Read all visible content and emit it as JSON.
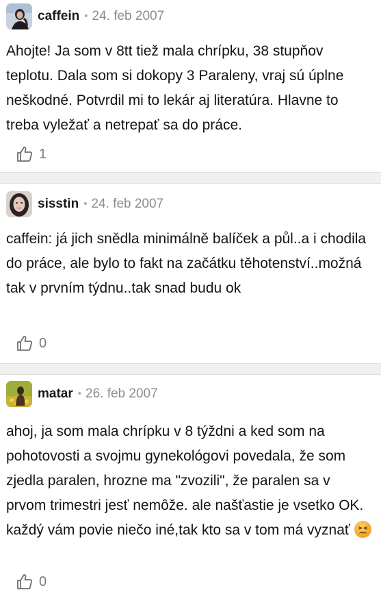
{
  "posts": [
    {
      "username": "caffein",
      "separator": "•",
      "date": "24. feb 2007",
      "text": "Ahojte! Ja som v 8tt tiež mala chrípku, 38 stupňov teplotu. Dala som si dokopy 3 Paraleny, vraj sú úplne neškodné. Potvrdil mi to lekár aj literatúra. Hlavne to treba vyležať a netrepať sa do práce.",
      "likes": "1",
      "like_icon": "thumbs-up-icon"
    },
    {
      "username": "sisstin",
      "separator": "•",
      "date": "24. feb 2007",
      "text": "caffein: já jich snědla minimálně balíček a půl..a i chodila do práce, ale bylo to fakt na začátku těhotenství..možná tak v prvním týdnu..tak snad budu ok",
      "likes": "0",
      "like_icon": "thumbs-up-icon"
    },
    {
      "username": "matar",
      "separator": "•",
      "date": "26. feb 2007",
      "text": "ahoj, ja som mala chrípku v 8 týždni a ked som na pohotovosti a svojmu gynekológovi povedala, že som zjedla paralen, hrozne ma \"zvozili\", že paralen sa v prvom trimestri jesť nemôže. ale našťastie je vsetko OK. každý vám povie niečo iné,tak kto sa v tom má vyznať",
      "emoji": "confounded-face-emoji",
      "likes": "0",
      "like_icon": "thumbs-up-icon"
    }
  ],
  "colors": {
    "username": "#1a1a1a",
    "date": "#8d8d8d",
    "divider": "#f0f0f0",
    "icon": "#6f6f6f"
  }
}
